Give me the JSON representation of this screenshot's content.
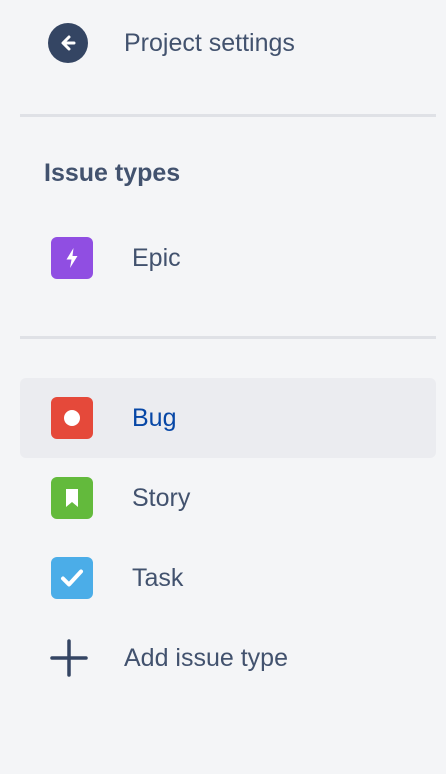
{
  "back": {
    "label": "Project settings",
    "icon": "arrow-left-circle-icon"
  },
  "section": {
    "heading": "Issue types"
  },
  "primary_types": [
    {
      "label": "Epic",
      "icon": "lightning-bolt-icon",
      "color": "#904ee2"
    }
  ],
  "standard_types": [
    {
      "label": "Bug",
      "icon": "bug-dot-icon",
      "color": "#e5493a",
      "selected": true
    },
    {
      "label": "Story",
      "icon": "bookmark-icon",
      "color": "#63ba3c"
    },
    {
      "label": "Task",
      "icon": "checkmark-icon",
      "color": "#4bade8"
    }
  ],
  "add": {
    "label": "Add issue type",
    "icon": "plus-icon"
  },
  "colors": {
    "background": "#f4f5f7",
    "selected_bg": "#ebecf0",
    "selected_text": "#0747a6",
    "text": "#42526e",
    "back_icon_bg": "#344563",
    "divider": "#dfe1e6"
  }
}
